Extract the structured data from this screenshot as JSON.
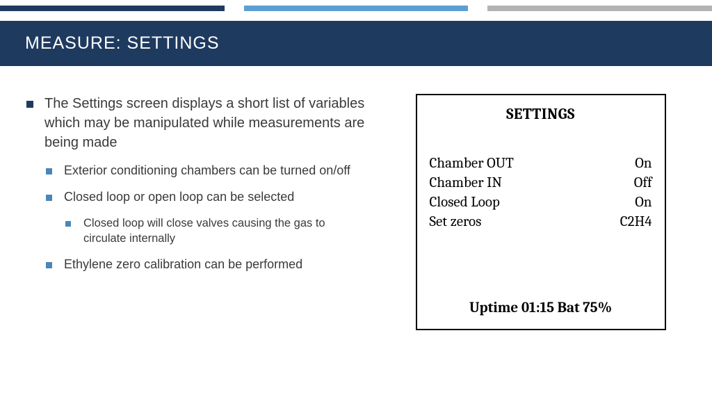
{
  "title": "MEASURE: SETTINGS",
  "bullets": {
    "main": "The Settings screen displays a short list of variables which may be manipulated while measurements are being made",
    "sub1": "Exterior conditioning chambers can be turned on/off",
    "sub2": "Closed loop or open loop can be selected",
    "sub2a": "Closed loop will close valves causing the gas to circulate internally",
    "sub3": "Ethylene zero calibration can be performed"
  },
  "panel": {
    "title": "SETTINGS",
    "rows": [
      {
        "label": "Chamber OUT",
        "value": "On"
      },
      {
        "label": "Chamber IN",
        "value": "Off"
      },
      {
        "label": "Closed Loop",
        "value": "On"
      },
      {
        "label": "Set zeros",
        "value": "C2H4"
      }
    ],
    "status": "Uptime 01:15 Bat 75%"
  }
}
